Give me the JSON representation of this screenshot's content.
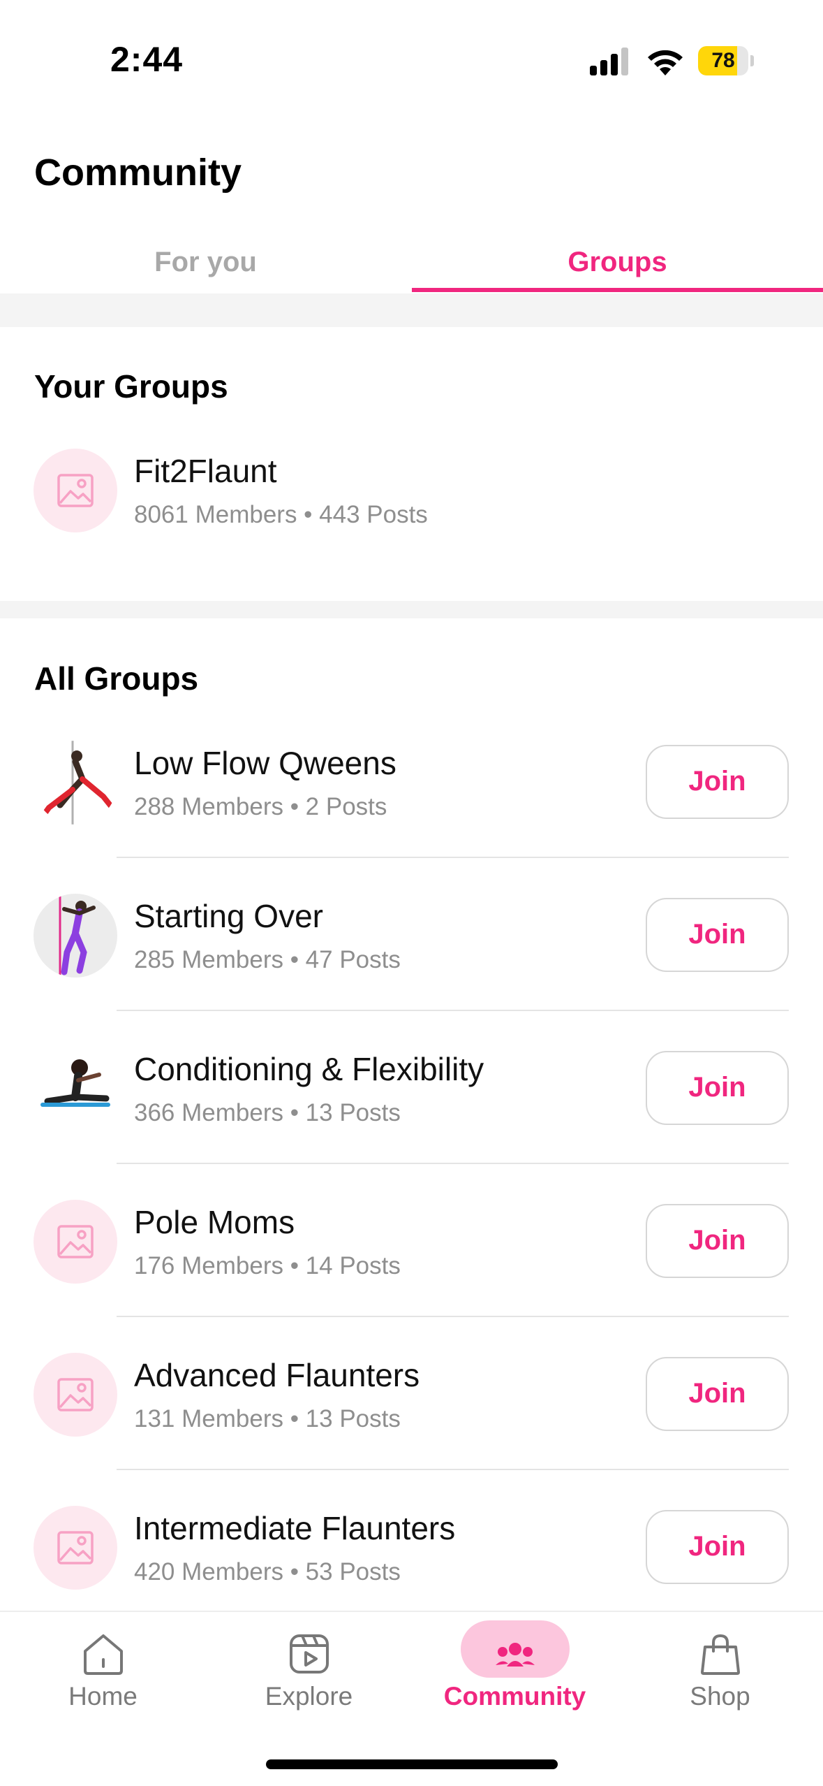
{
  "status_bar": {
    "time": "2:44",
    "battery_level": "78",
    "battery_fraction": 0.78
  },
  "header": {
    "title": "Community"
  },
  "tabs": [
    {
      "label": "For you",
      "active": false
    },
    {
      "label": "Groups",
      "active": true
    }
  ],
  "your_groups": {
    "title": "Your Groups",
    "items": [
      {
        "name": "Fit2Flaunt",
        "stats": "8061 Members • 443 Posts",
        "avatar": "image-placeholder-icon"
      }
    ]
  },
  "all_groups": {
    "title": "All Groups",
    "join_label": "Join",
    "items": [
      {
        "name": "Low Flow Qweens",
        "stats": "288 Members • 2 Posts",
        "avatar": "photo-pole-dancer"
      },
      {
        "name": "Starting Over",
        "stats": "285 Members • 47 Posts",
        "avatar": "photo-pole-dancer-purple"
      },
      {
        "name": "Conditioning & Flexibility",
        "stats": "366 Members • 13 Posts",
        "avatar": "photo-stretching"
      },
      {
        "name": "Pole Moms",
        "stats": "176 Members • 14 Posts",
        "avatar": "image-placeholder-icon"
      },
      {
        "name": "Advanced Flaunters",
        "stats": "131 Members • 13 Posts",
        "avatar": "image-placeholder-icon"
      },
      {
        "name": "Intermediate Flaunters",
        "stats": "420 Members • 53 Posts",
        "avatar": "image-placeholder-icon"
      }
    ]
  },
  "bottom_nav": [
    {
      "label": "Home",
      "icon": "home-icon",
      "active": false
    },
    {
      "label": "Explore",
      "icon": "play-icon",
      "active": false
    },
    {
      "label": "Community",
      "icon": "community-icon",
      "active": true
    },
    {
      "label": "Shop",
      "icon": "shopping-bag-icon",
      "active": false
    }
  ],
  "colors": {
    "accent": "#f0267f",
    "accent_soft": "#fcc6dd",
    "placeholder_bg": "#fde8ef",
    "muted_text": "#8e8e8e",
    "battery": "#ffd60a"
  }
}
